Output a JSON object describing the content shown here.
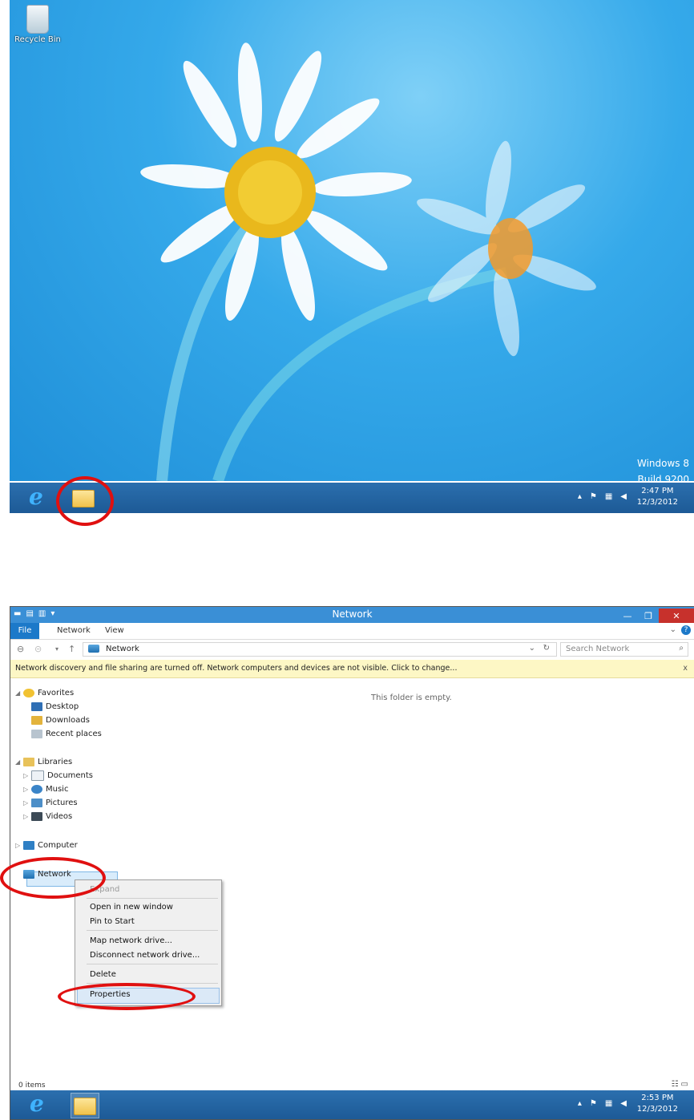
{
  "desktop": {
    "recycle_bin_label": "Recycle Bin",
    "watermark_line1": "Windows 8",
    "watermark_line2": "Build 9200",
    "taskbar": {
      "apps": [
        "internet-explorer",
        "file-explorer"
      ],
      "ie_glyph": "e",
      "clock_time": "2:47 PM",
      "clock_date": "12/3/2012",
      "tray_icons": [
        "show-hidden-icons",
        "action-center-flag",
        "network",
        "volume"
      ]
    }
  },
  "explorer": {
    "window_title": "Network",
    "ribbon_tabs": [
      "File",
      "Network",
      "View"
    ],
    "address_path": "Network",
    "search_placeholder": "Search Network",
    "infobar_message": "Network discovery and file sharing are turned off. Network computers and devices are not visible. Click to change...",
    "infobar_close": "x",
    "empty_message": "This folder is empty.",
    "nav": {
      "favorites": "Favorites",
      "desktop": "Desktop",
      "downloads": "Downloads",
      "recent_places": "Recent places",
      "libraries": "Libraries",
      "documents": "Documents",
      "music": "Music",
      "pictures": "Pictures",
      "videos": "Videos",
      "computer": "Computer",
      "network": "Network"
    },
    "context_menu": {
      "expand": "Expand",
      "open_new_window": "Open in new window",
      "pin_to_start": "Pin to Start",
      "map_drive": "Map network drive...",
      "disconnect_drive": "Disconnect network drive...",
      "delete": "Delete",
      "properties": "Properties"
    },
    "status_items": "0 items",
    "taskbar": {
      "ie_glyph": "e",
      "clock_time": "2:53 PM",
      "clock_date": "12/3/2012"
    }
  },
  "colors": {
    "accent": "#1c79c9",
    "taskbar": "#1d5a96",
    "highlight_circle": "#e01010",
    "infobar": "#fdf7c5"
  }
}
